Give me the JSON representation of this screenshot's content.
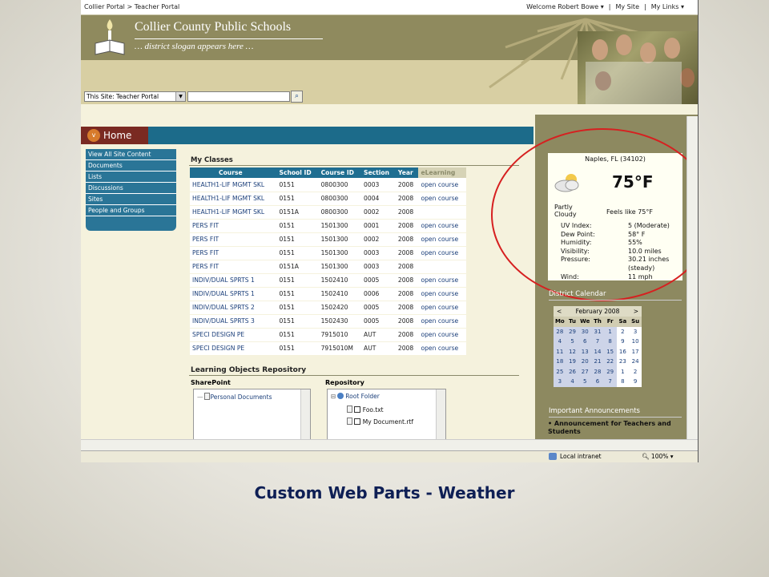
{
  "breadcrumb": {
    "root": "Collier Portal",
    "sep": ">",
    "current": "Teacher Portal"
  },
  "toplinks": {
    "welcome": "Welcome Robert Bowe",
    "mysite": "My Site",
    "mylinks": "My Links"
  },
  "header": {
    "school_name": "Collier County Public Schools",
    "slogan": "… district slogan appears here …"
  },
  "search": {
    "scope": "This Site: Teacher Portal",
    "value": ""
  },
  "home_tab": "Home",
  "leftnav": [
    "View All Site Content",
    "Documents",
    "Lists",
    "Discussions",
    "Sites",
    "People and Groups"
  ],
  "my_classes": {
    "title": "My Classes",
    "columns": [
      "Course",
      "School ID",
      "Course ID",
      "Section",
      "Year",
      "eLearning"
    ],
    "rows": [
      [
        "HEALTH1-LIF MGMT SKL",
        "0151",
        "0800300",
        "0003",
        "2008",
        "open course"
      ],
      [
        "HEALTH1-LIF MGMT SKL",
        "0151",
        "0800300",
        "0004",
        "2008",
        "open course"
      ],
      [
        "HEALTH1-LIF MGMT SKL",
        "0151A",
        "0800300",
        "0002",
        "2008",
        ""
      ],
      [
        "PERS FIT",
        "0151",
        "1501300",
        "0001",
        "2008",
        "open course"
      ],
      [
        "PERS FIT",
        "0151",
        "1501300",
        "0002",
        "2008",
        "open course"
      ],
      [
        "PERS FIT",
        "0151",
        "1501300",
        "0003",
        "2008",
        "open course"
      ],
      [
        "PERS FIT",
        "0151A",
        "1501300",
        "0003",
        "2008",
        ""
      ],
      [
        "INDIV/DUAL SPRTS 1",
        "0151",
        "1502410",
        "0005",
        "2008",
        "open course"
      ],
      [
        "INDIV/DUAL SPRTS 1",
        "0151",
        "1502410",
        "0006",
        "2008",
        "open course"
      ],
      [
        "INDIV/DUAL SPRTS 2",
        "0151",
        "1502420",
        "0005",
        "2008",
        "open course"
      ],
      [
        "INDIV/DUAL SPRTS 3",
        "0151",
        "1502430",
        "0005",
        "2008",
        "open course"
      ],
      [
        "SPECI DESIGN PE",
        "0151",
        "7915010",
        "AUT",
        "2008",
        "open course"
      ],
      [
        "SPECI DESIGN PE",
        "0151",
        "7915010M",
        "AUT",
        "2008",
        "open course"
      ]
    ]
  },
  "lor": {
    "title": "Learning Objects Repository",
    "sharepoint_label": "SharePoint",
    "repository_label": "Repository",
    "sp_items": [
      "Personal Documents"
    ],
    "repo_root": "Root Folder",
    "repo_items": [
      "Foo.txt",
      "My Document.rtf"
    ]
  },
  "weather": {
    "location": "Naples, FL (34102)",
    "temp": "75°F",
    "condition_l1": "Partly",
    "condition_l2": "Cloudy",
    "feels": "Feels like 75°F",
    "details": [
      {
        "k": "UV Index:",
        "v": "5 (Moderate)"
      },
      {
        "k": "Dew Point:",
        "v": "58° F"
      },
      {
        "k": "Humidity:",
        "v": "55%"
      },
      {
        "k": "Visibility:",
        "v": "10.0 miles"
      },
      {
        "k": "Pressure:",
        "v": "30.21 inches"
      },
      {
        "k": "",
        "v": "(steady)"
      },
      {
        "k": "Wind:",
        "v": "11 mph"
      }
    ]
  },
  "calendar": {
    "title": "District Calendar",
    "month": "February 2008",
    "prev": "<",
    "next": ">",
    "days": [
      "Mo",
      "Tu",
      "We",
      "Th",
      "Fr",
      "Sa",
      "Su"
    ],
    "weeks": [
      [
        "28",
        "29",
        "30",
        "31",
        "1",
        "2",
        "3"
      ],
      [
        "4",
        "5",
        "6",
        "7",
        "8",
        "9",
        "10"
      ],
      [
        "11",
        "12",
        "13",
        "14",
        "15",
        "16",
        "17"
      ],
      [
        "18",
        "19",
        "20",
        "21",
        "22",
        "23",
        "24"
      ],
      [
        "25",
        "26",
        "27",
        "28",
        "29",
        "1",
        "2"
      ],
      [
        "3",
        "4",
        "5",
        "6",
        "7",
        "8",
        "9"
      ]
    ]
  },
  "announcements": {
    "title": "Important Announcements",
    "item": "Announcement for Teachers and Students"
  },
  "status": {
    "zone": "Local intranet",
    "zoom": "100%"
  },
  "caption": "Custom Web Parts - Weather",
  "colors": {
    "accent": "#1f6e91",
    "home_tab": "#7a2a22",
    "highlight_ellipse": "#d62020"
  }
}
